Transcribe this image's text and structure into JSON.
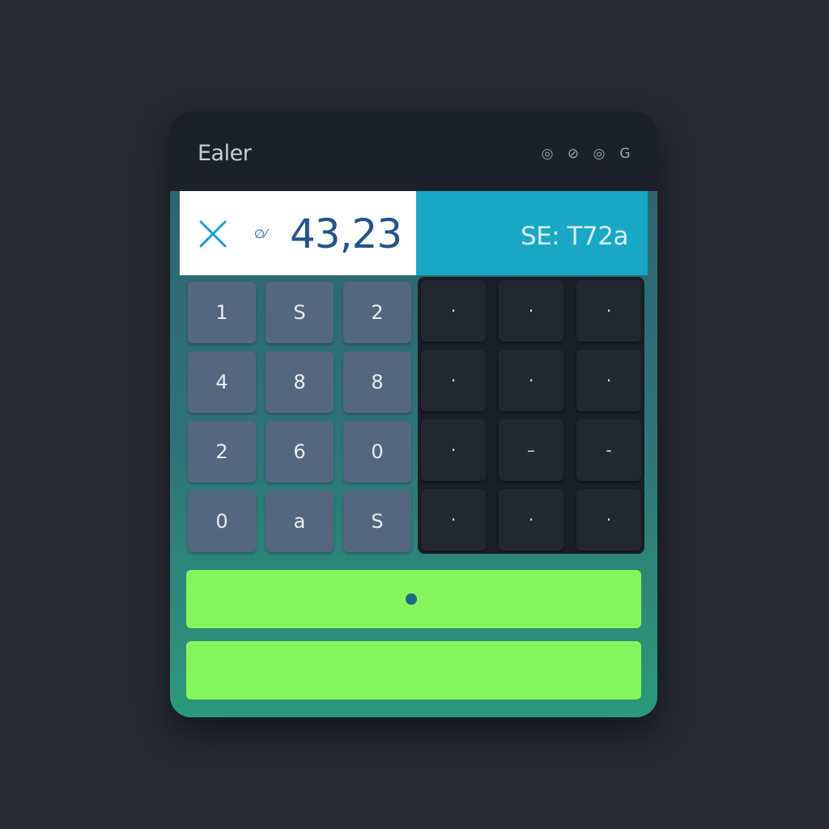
{
  "window": {
    "title": "Ealer",
    "controls": [
      "◎",
      "⊘",
      "◎",
      "G"
    ]
  },
  "display": {
    "aux_glyph": "∅⁄",
    "value": "43,23",
    "secondary_value": "SE: T72a"
  },
  "colors": {
    "background": "#262833",
    "accent_cyan": "#18a8c6",
    "accent_green": "#86f55c",
    "close_icon": "#1aa0d0"
  },
  "keypad": {
    "light_keys": [
      "1",
      "S",
      "2",
      "4",
      "8",
      "8",
      "2",
      "6",
      "0",
      "0",
      "a",
      "S"
    ],
    "dark_keys": [
      "·",
      "·",
      "·",
      "·",
      "·",
      "·",
      "·",
      "–",
      "-",
      "·",
      "·",
      "·"
    ]
  },
  "actions": {
    "primary_indicator": "dot",
    "secondary": ""
  }
}
